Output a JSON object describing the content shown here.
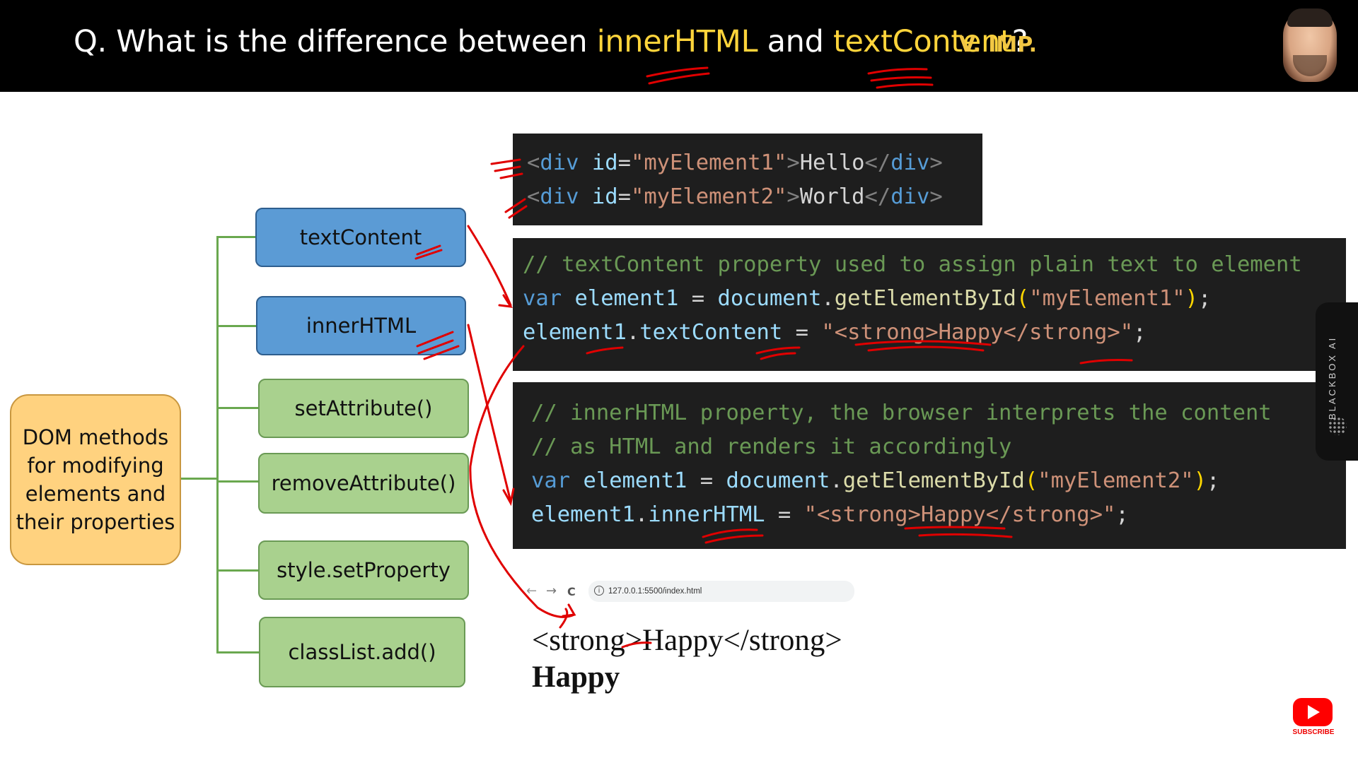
{
  "header": {
    "title_prefix": "Q. What is the difference between ",
    "title_kw1": "innerHTML",
    "title_mid": " and ",
    "title_kw2": "textContent",
    "title_suffix": "?",
    "tag": "V. IMP."
  },
  "tree": {
    "root": "DOM methods for modifying elements and their properties",
    "items": [
      {
        "label": "textContent",
        "color": "blue"
      },
      {
        "label": "innerHTML",
        "color": "blue"
      },
      {
        "label": "setAttribute()",
        "color": "green"
      },
      {
        "label": "removeAttribute()",
        "color": "green"
      },
      {
        "label": "style.setProperty",
        "color": "green"
      },
      {
        "label": "classList.add()",
        "color": "green"
      }
    ]
  },
  "code_html": {
    "line1": {
      "open": "<",
      "tag": "div",
      "attr": "id",
      "eq": "=",
      "val": "\"myElement1\"",
      "close": ">",
      "text": "Hello",
      "endopen": "</",
      "endtag": "div",
      "endclose": ">"
    },
    "line2": {
      "open": "<",
      "tag": "div",
      "attr": "id",
      "eq": "=",
      "val": "\"myElement2\"",
      "close": ">",
      "text": "World",
      "endopen": "</",
      "endtag": "div",
      "endclose": ">"
    }
  },
  "code_text": {
    "comment": "// textContent property used to assign plain text to element",
    "l2": {
      "kw": "var",
      "var": "element1",
      "eq": " = ",
      "obj": "document",
      "dot": ".",
      "fn": "getElementById",
      "lp": "(",
      "arg": "\"myElement1\"",
      "rp": ")",
      "semi": ";"
    },
    "l3": {
      "var": "element1",
      "dot": ".",
      "prop": "textContent",
      "eq": " = ",
      "str": "\"<strong>Happy</strong>\"",
      "semi": ";"
    }
  },
  "code_inner": {
    "comment1": "// innerHTML property, the browser interprets the content",
    "comment2": "// as HTML and renders it accordingly",
    "l3": {
      "kw": "var",
      "var": "element1",
      "eq": " = ",
      "obj": "document",
      "dot": ".",
      "fn": "getElementById",
      "lp": "(",
      "arg": "\"myElement2\"",
      "rp": ")",
      "semi": ";"
    },
    "l4": {
      "var": "element1",
      "dot": ".",
      "prop": "innerHTML",
      "eq": " = ",
      "str": "\"<strong>Happy</strong>\"",
      "semi": ";"
    }
  },
  "browser": {
    "back_icon": "←",
    "forward_icon": "→",
    "reload_icon": "C",
    "info_icon": "i",
    "url": "127.0.0.1:5500/index.html",
    "output_plain": "<strong>Happy</strong>",
    "output_bold": "Happy"
  },
  "side_widget": {
    "label": "BLACKBOX AI"
  },
  "subscribe": {
    "label": "SUBSCRIBE"
  },
  "colors": {
    "header_bg": "#000000",
    "keyword": "#ffd43b",
    "tag": "#f2c744",
    "blue_box": "#5b9bd5",
    "green_box": "#a9d18e",
    "root_box": "#ffd27f",
    "annotation": "#e00000"
  }
}
